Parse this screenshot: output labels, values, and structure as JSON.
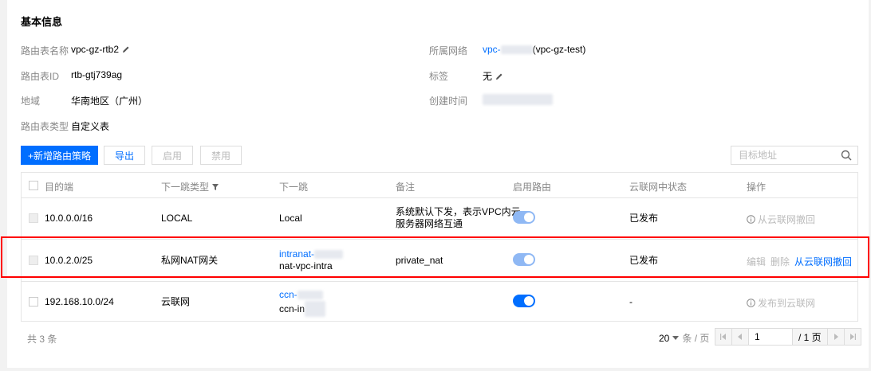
{
  "basic_info": {
    "title": "基本信息",
    "route_table_name": {
      "label": "路由表名称",
      "value": "vpc-gz-rtb2"
    },
    "route_table_id": {
      "label": "路由表ID",
      "value": "rtb-gtj739ag"
    },
    "region": {
      "label": "地域",
      "value": "华南地区（广州）"
    },
    "route_table_type": {
      "label": "路由表类型",
      "value": "自定义表"
    },
    "vpc": {
      "label": "所属网络",
      "value_prefix": "vpc-",
      "value_suffix": "(vpc-gz-test)"
    },
    "tags": {
      "label": "标签",
      "value": "无"
    },
    "created_time": {
      "label": "创建时间"
    }
  },
  "toolbar": {
    "add_label": "+新增路由策略",
    "export_label": "导出",
    "enable_label": "启用",
    "disable_label": "禁用",
    "search_placeholder": "目标地址"
  },
  "table": {
    "columns": [
      "目的端",
      "下一跳类型",
      "下一跳",
      "备注",
      "启用路由",
      "云联网中状态",
      "操作"
    ],
    "rows": [
      {
        "destination": "10.0.0.0/16",
        "next_hop_type": "LOCAL",
        "next_hop_line1": "Local",
        "next_hop_line2": "",
        "remark_line1": "系统默认下发，表示VPC内云",
        "remark_line2": "服务器网络互通",
        "enabled": true,
        "ccn_status": "已发布",
        "op_main": "从云联网撤回"
      },
      {
        "destination": "10.0.2.0/25",
        "next_hop_type": "私网NAT网关",
        "next_hop_line1": "intranat-",
        "next_hop_line2": "nat-vpc-intra",
        "remark_line1": "private_nat",
        "remark_line2": "",
        "enabled": true,
        "ccn_status": "已发布",
        "op_edit": "编辑",
        "op_delete": "删除",
        "op_main": "从云联网撤回"
      },
      {
        "destination": "192.168.10.0/24",
        "next_hop_type": "云联网",
        "next_hop_line1": "ccn-",
        "next_hop_line2": "ccn-in",
        "remark_line1": "",
        "remark_line2": "",
        "enabled": true,
        "ccn_status": "-",
        "op_main": "发布到云联网"
      }
    ]
  },
  "footer": {
    "total": "共 3 条",
    "page_size": "20",
    "page_size_unit": "条 / 页",
    "current_page": "1",
    "total_pages": "/ 1 页"
  },
  "colors": {
    "accent": "#006eff",
    "highlight": "#ff0000"
  }
}
